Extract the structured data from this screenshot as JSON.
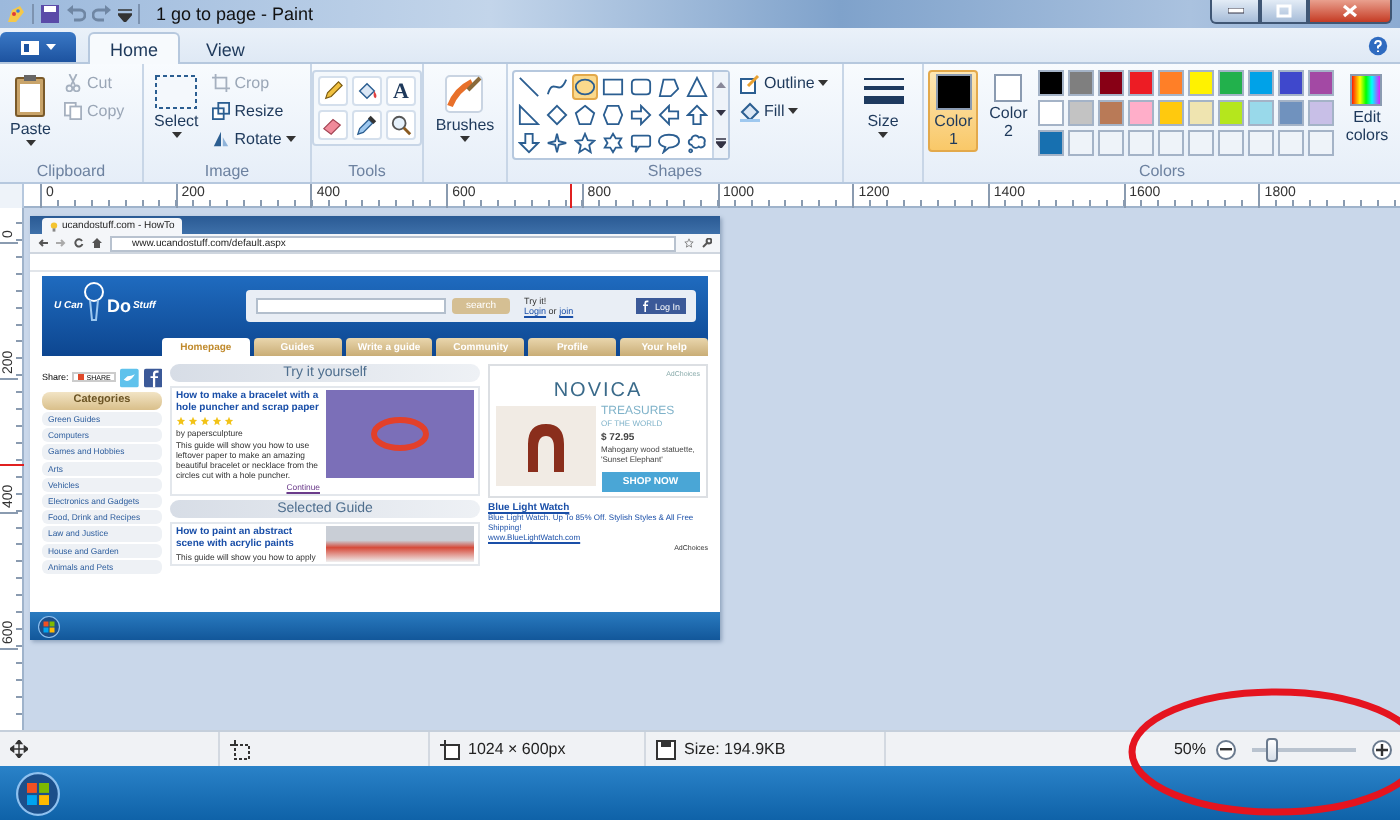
{
  "window": {
    "title": "1 go to page - Paint"
  },
  "tabs": [
    {
      "label": "Home",
      "selected": true
    },
    {
      "label": "View",
      "selected": false
    }
  ],
  "ribbon": {
    "clipboard": {
      "label": "Clipboard",
      "paste": "Paste",
      "actions": [
        {
          "kind": "cut",
          "label": "Cut",
          "disabled": true
        },
        {
          "kind": "copy",
          "label": "Copy",
          "disabled": true
        }
      ]
    },
    "image": {
      "label": "Image",
      "select": "Select",
      "actions": [
        {
          "kind": "crop",
          "label": "Crop",
          "disabled": true
        },
        {
          "kind": "resize",
          "label": "Resize",
          "disabled": false
        },
        {
          "kind": "rotate",
          "label": "Rotate",
          "disabled": false
        }
      ]
    },
    "tools": {
      "label": "Tools",
      "items": [
        {
          "kind": "pencil"
        },
        {
          "kind": "fill"
        },
        {
          "kind": "text",
          "glyph": "A"
        },
        {
          "kind": "eraser"
        },
        {
          "kind": "color-picker"
        },
        {
          "kind": "magnifier"
        }
      ]
    },
    "brushes": {
      "label": "Brushes"
    },
    "shapes": {
      "label": "Shapes",
      "outline": "Outline",
      "fill": "Fill",
      "items": [
        {
          "kind": "line",
          "selected": false
        },
        {
          "kind": "curve",
          "selected": false
        },
        {
          "kind": "oval",
          "selected": true
        },
        {
          "kind": "rectangle",
          "selected": false
        },
        {
          "kind": "rounded-rectangle",
          "selected": false
        },
        {
          "kind": "polygon",
          "selected": false
        },
        {
          "kind": "triangle",
          "selected": false
        },
        {
          "kind": "right-triangle",
          "selected": false
        },
        {
          "kind": "diamond",
          "selected": false
        },
        {
          "kind": "pentagon",
          "selected": false
        },
        {
          "kind": "hexagon",
          "selected": false
        },
        {
          "kind": "right-arrow",
          "selected": false
        },
        {
          "kind": "left-arrow",
          "selected": false
        },
        {
          "kind": "up-arrow",
          "selected": false
        },
        {
          "kind": "down-arrow",
          "selected": false
        },
        {
          "kind": "four-point-star",
          "selected": false
        },
        {
          "kind": "five-point-star",
          "selected": false
        },
        {
          "kind": "six-point-star",
          "selected": false
        },
        {
          "kind": "rounded-callout",
          "selected": false
        },
        {
          "kind": "oval-callout",
          "selected": false
        },
        {
          "kind": "cloud-callout",
          "selected": false
        }
      ]
    },
    "size": {
      "label": "Size"
    },
    "colors": {
      "label": "Colors",
      "edit": "Edit colors",
      "color1": {
        "label": "Color 1",
        "color": "#000000",
        "selected": true
      },
      "color2": {
        "label": "Color 2",
        "color": "#ffffff",
        "selected": false
      },
      "palette": [
        {
          "color": "#000000"
        },
        {
          "color": "#7f7f7f"
        },
        {
          "color": "#880015"
        },
        {
          "color": "#ed1c24"
        },
        {
          "color": "#ff7f27"
        },
        {
          "color": "#fff200"
        },
        {
          "color": "#22b14c"
        },
        {
          "color": "#00a2e8"
        },
        {
          "color": "#3f48cc"
        },
        {
          "color": "#a349a4"
        },
        {
          "color": "#ffffff"
        },
        {
          "color": "#c3c3c3"
        },
        {
          "color": "#b97a57"
        },
        {
          "color": "#ffaec9"
        },
        {
          "color": "#ffc90e"
        },
        {
          "color": "#efe4b0"
        },
        {
          "color": "#b5e61d"
        },
        {
          "color": "#99d9ea"
        },
        {
          "color": "#7092be"
        },
        {
          "color": "#c8bfe7"
        },
        {
          "color": "#1770b0"
        }
      ]
    }
  },
  "rulers": {
    "horizontal": [
      "0",
      "200",
      "400",
      "600",
      "800",
      "1000",
      "1200",
      "1400",
      "1600",
      "1800"
    ],
    "vertical": [
      "0",
      "200",
      "400",
      "600"
    ]
  },
  "canvas_image": {
    "browser": {
      "tab_title": "ucandostuff.com - HowTo",
      "address": "www.ucandostuff.com/default.aspx"
    },
    "logo": {
      "before": "U Can",
      "mark": "Do",
      "after": "Stuff"
    },
    "search_button": "search",
    "try_it": "Try it!",
    "login": "Login",
    "or": "or",
    "join": "join",
    "log_in_button": "Log In",
    "nav": [
      {
        "label": "Homepage",
        "selected": true
      },
      {
        "label": "Guides",
        "selected": false
      },
      {
        "label": "Write a guide",
        "selected": false
      },
      {
        "label": "Community",
        "selected": false
      },
      {
        "label": "Profile",
        "selected": false
      },
      {
        "label": "Your help",
        "selected": false
      }
    ],
    "share_label": "Share:",
    "share_button": "SHARE",
    "categories_title": "Categories",
    "categories": [
      "Green Guides",
      "Computers",
      "Games and Hobbies",
      "Arts",
      "Vehicles",
      "Electronics and Gadgets",
      "Food, Drink and Recipes",
      "Law and Justice",
      "House and Garden",
      "Animals and Pets"
    ],
    "featured": {
      "heading": "Try it yourself",
      "title": "How to make a bracelet with a hole puncher and scrap paper",
      "stars": 5,
      "author": "by papersculpture",
      "summary": "This guide will show you how to use leftover paper to make an amazing beautiful bracelet or necklace from the circles cut with a hole puncher.",
      "link": "Continue"
    },
    "selected_guide": {
      "heading": "Selected Guide",
      "title": "How to paint an abstract scene with acrylic paints",
      "summary": "This guide will show you how to apply"
    },
    "ad": {
      "choices": "AdChoices",
      "brand": "NOVICA",
      "headline": "TREASURES",
      "subline": "OF THE WORLD",
      "price": "$ 72.95",
      "description": "Mahogany wood statuette, 'Sunset Elephant'",
      "button": "SHOP NOW"
    },
    "text_ad": {
      "title": "Blue Light Watch",
      "body": "Blue Light Watch. Up To 85% Off. Stylish Styles & All Free Shipping!",
      "url": "www.BlueLightWatch.com",
      "choices": "AdChoices"
    }
  },
  "status_bar": {
    "dimensions": "1024 × 600px",
    "file_size": "Size: 194.9KB",
    "zoom": "50%",
    "level": 0.2
  }
}
